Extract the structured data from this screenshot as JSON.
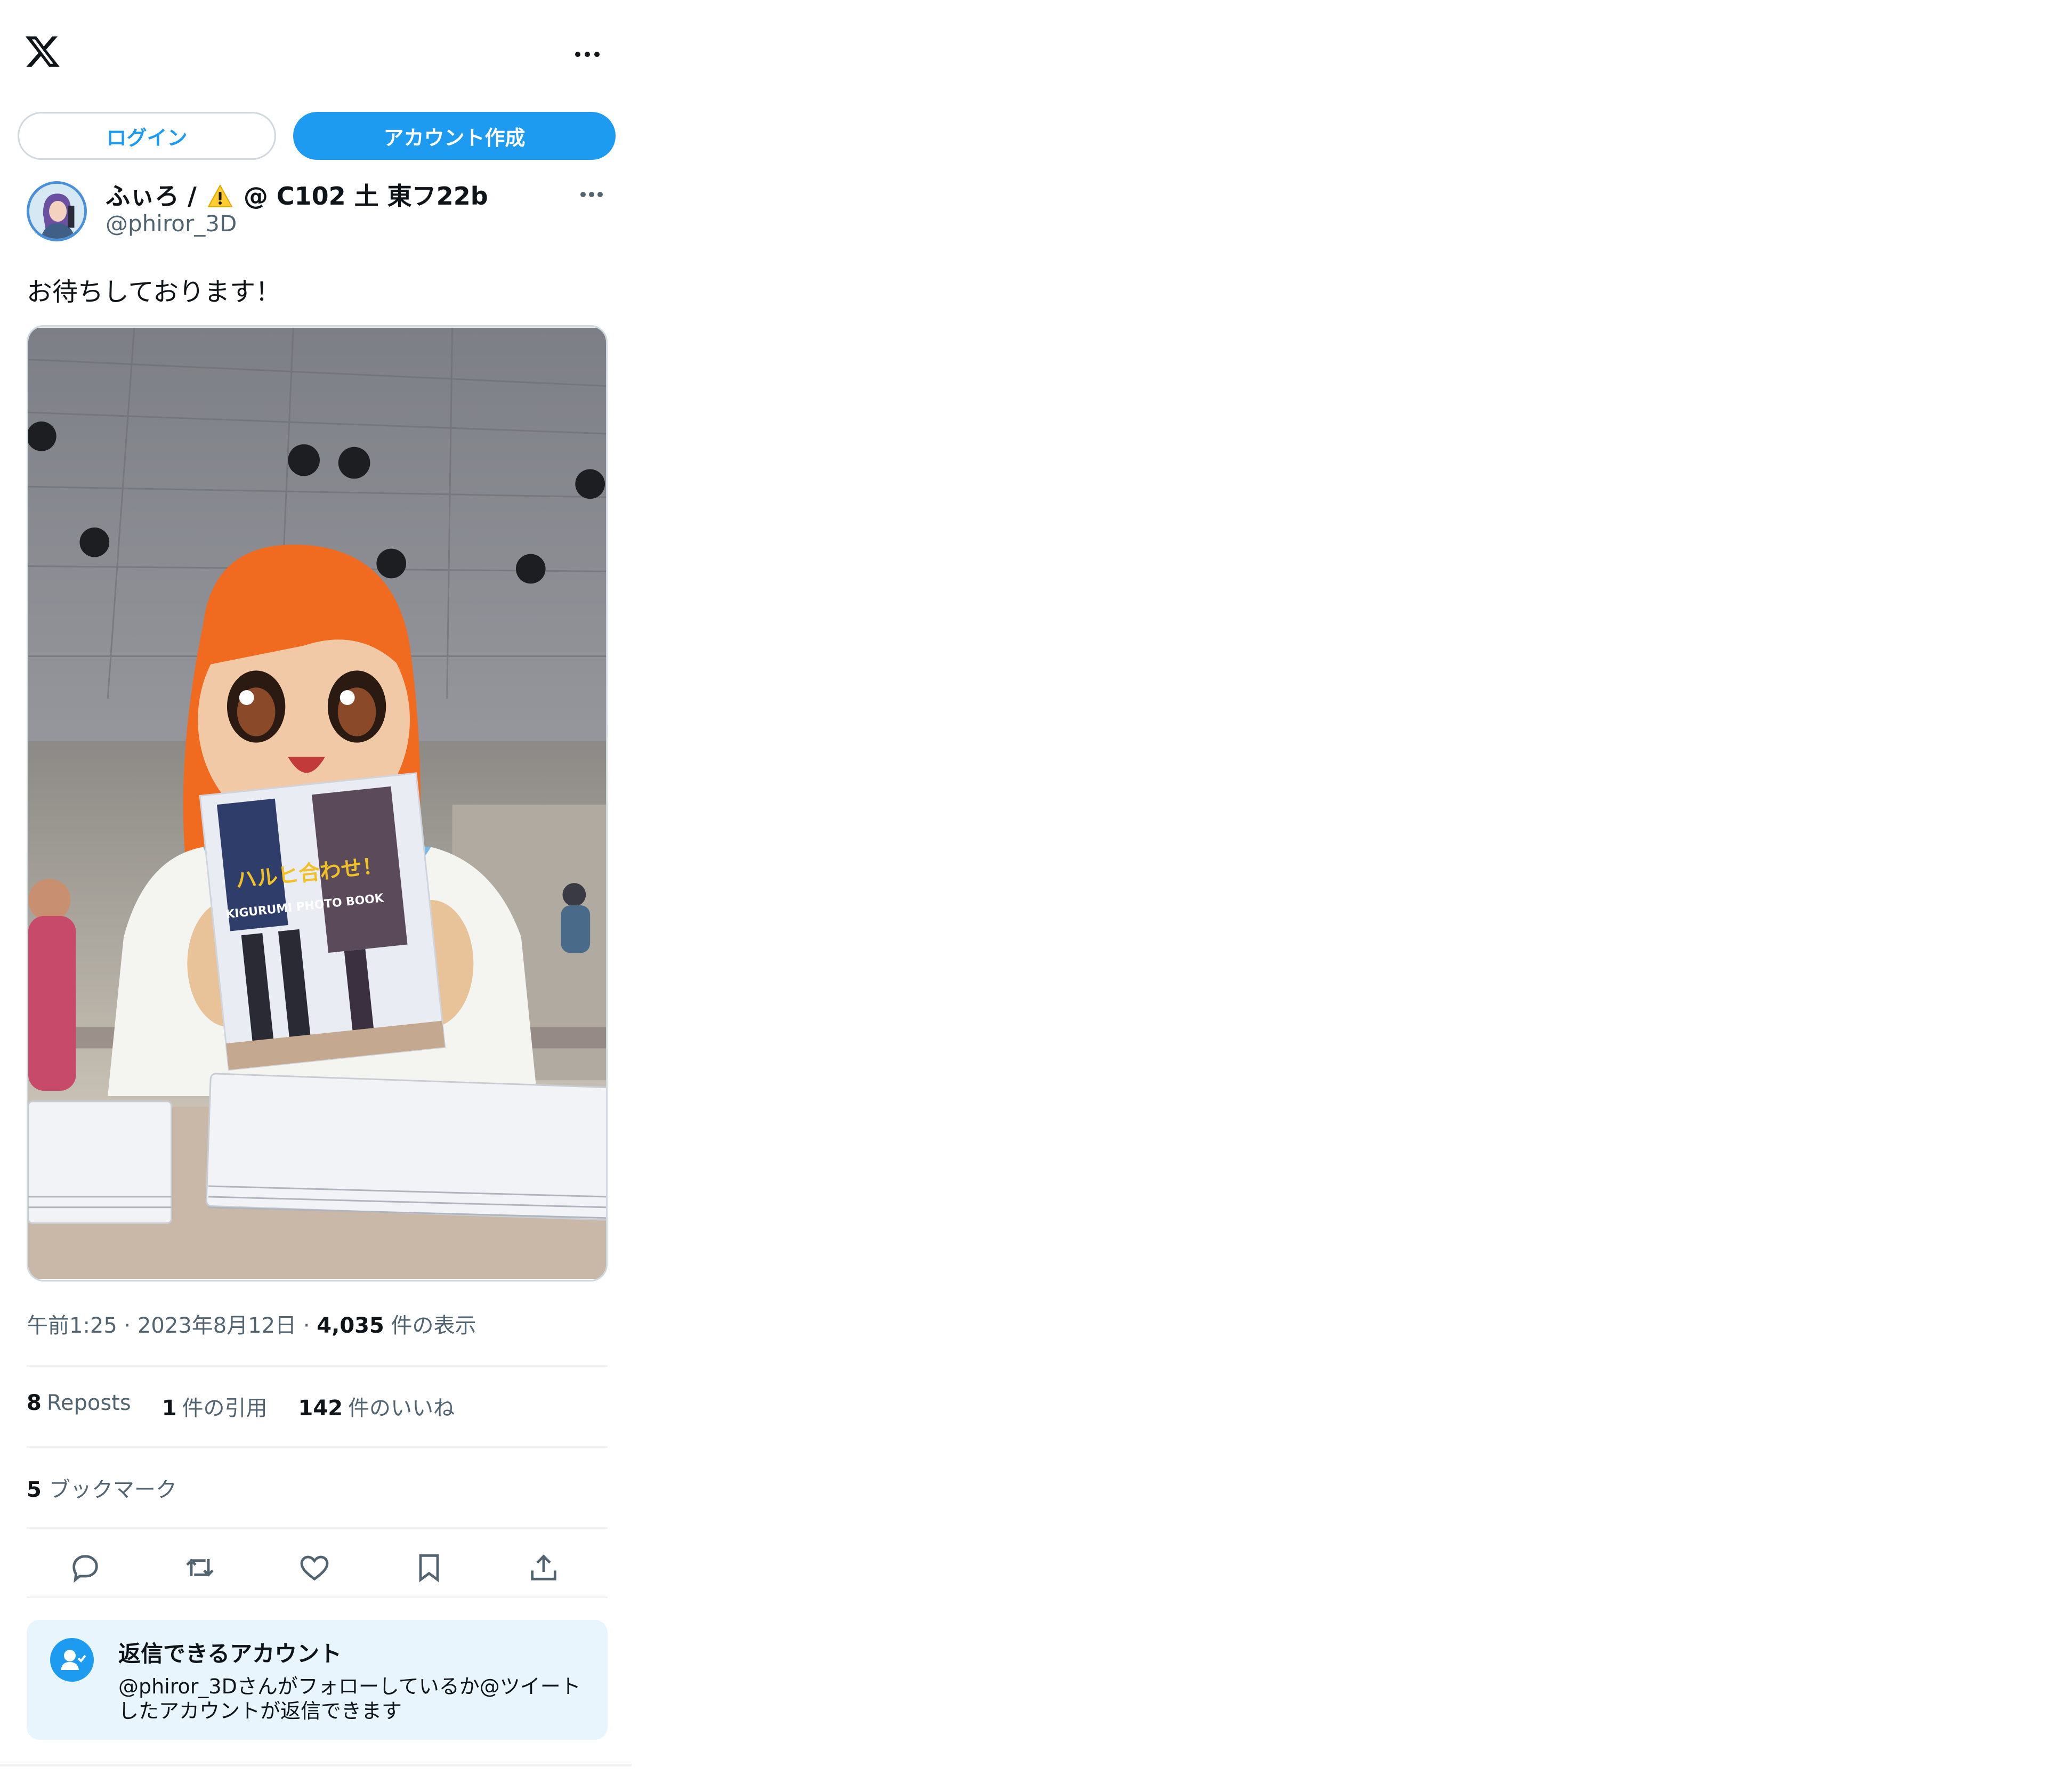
{
  "header": {
    "logo": "x-logo-icon",
    "more": "more-horizontal-icon"
  },
  "auth": {
    "login_label": "ログイン",
    "signup_label": "アカウント作成"
  },
  "post": {
    "display_name_prefix": "ふぃろ /",
    "display_name_suffix": "@ C102 土 東フ22b",
    "warning_emoji": "⚠️",
    "handle": "@phiror_3D",
    "text": "お待ちしております！",
    "media": {
      "book_title": "ハルヒ合わせ！",
      "book_subtitle": "KIGURUMI PHOTO BOOK"
    },
    "time": "午前1:25",
    "date": "2023年8月12日",
    "views_count": "4,035",
    "views_label": "件の表示",
    "reposts_count": "8",
    "reposts_label": "Reposts",
    "quotes_count": "1",
    "quotes_label": "件の引用",
    "likes_count": "142",
    "likes_label": "件のいいね",
    "bookmarks_count": "5",
    "bookmarks_label": "ブックマーク"
  },
  "actions": [
    "reply-icon",
    "repost-icon",
    "like-icon",
    "bookmark-icon",
    "share-icon"
  ],
  "reply_restriction": {
    "title": "返信できるアカウント",
    "description": "@phiror_3Dさんがフォローしているか@ツイートしたアカウントが返信できます"
  },
  "colors": {
    "accent": "#1d9bf0",
    "text": "#0f1419",
    "muted": "#536471",
    "border": "#eff3f4",
    "info_bg": "#e8f5fd"
  }
}
